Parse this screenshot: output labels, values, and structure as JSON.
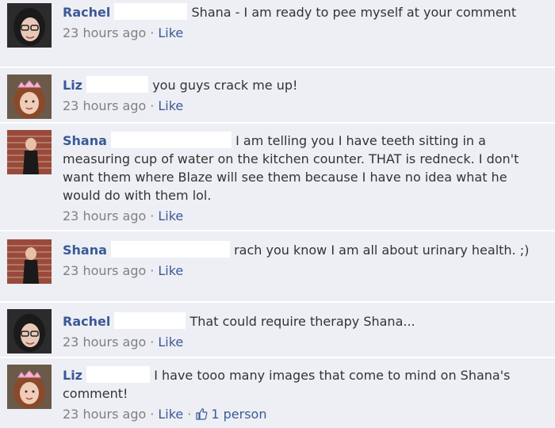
{
  "comments": [
    {
      "author": "Rachel",
      "avatar": "woman-glasses-avatar",
      "text": "Shana - I am ready to pee myself at your comment",
      "timestamp": "23 hours ago",
      "like_label": "Like"
    },
    {
      "author": "Liz",
      "avatar": "girl-tiara-avatar",
      "text": "you guys crack me up!",
      "timestamp": "23 hours ago",
      "like_label": "Like"
    },
    {
      "author": "Shana",
      "avatar": "boy-brick-wall-avatar",
      "text": "I am telling you I have teeth sitting in a measuring cup of water on the kitchen counter. THAT is redneck. I don't want them where Blaze will see them because I have no idea what he would do with them lol.",
      "timestamp": "23 hours ago",
      "like_label": "Like"
    },
    {
      "author": "Shana",
      "avatar": "boy-brick-wall-avatar",
      "text": "rach you know I am all about urinary health. ;)",
      "timestamp": "23 hours ago",
      "like_label": "Like"
    },
    {
      "author": "Rachel",
      "avatar": "woman-glasses-avatar",
      "text": "That could require therapy Shana...",
      "timestamp": "23 hours ago",
      "like_label": "Like"
    },
    {
      "author": "Liz",
      "avatar": "girl-tiara-avatar",
      "text": "I have tooo many images that come to mind on Shana's comment!",
      "timestamp": "23 hours ago",
      "like_label": "Like",
      "likes_count": "1 person"
    }
  ],
  "separator": "·",
  "colors": {
    "background": "#edeff4",
    "author_link": "#3b5998",
    "timestamp": "#808080",
    "text": "#333333"
  }
}
